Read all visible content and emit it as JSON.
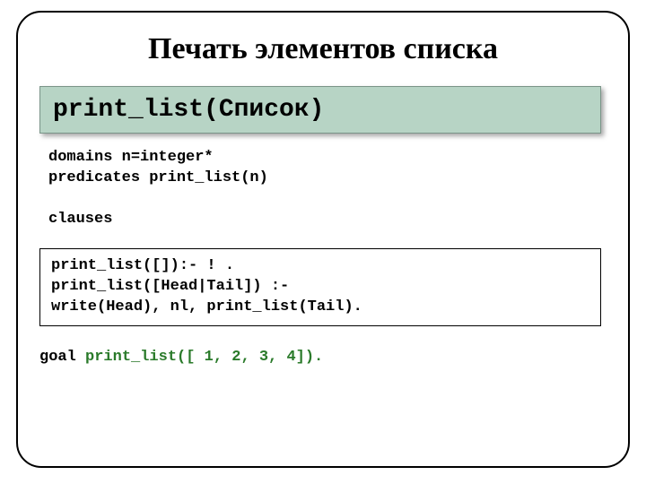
{
  "title": "Печать элементов списка",
  "header": "print_list(Список)",
  "declarations": "domains n=integer*\npredicates print_list(n)\n\nclauses",
  "code": "print_list([]):- ! .\nprint_list([Head|Tail]) :-\nwrite(Head), nl, print_list(Tail).",
  "goal": {
    "keyword": "goal ",
    "call": "print_list([ 1, 2, 3, 4])."
  }
}
